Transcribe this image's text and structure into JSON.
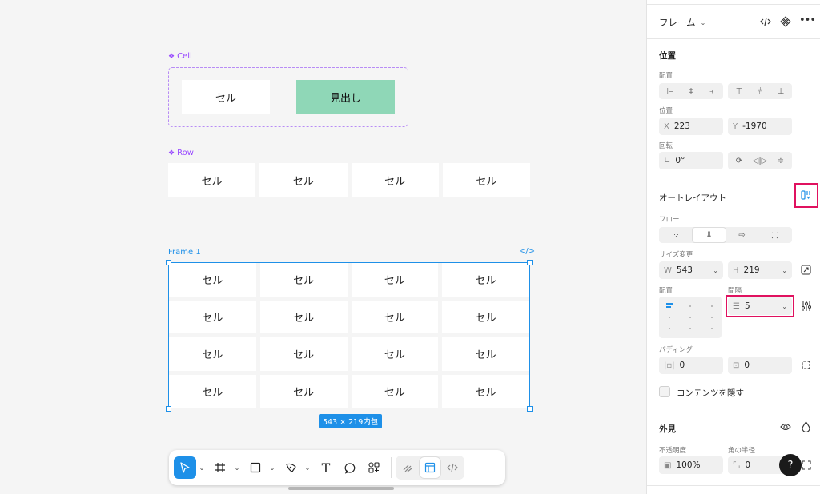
{
  "canvas": {
    "cell_component": {
      "label": "Cell",
      "cell_text": "セル",
      "heading_text": "見出し"
    },
    "row_component": {
      "label": "Row",
      "cells": [
        "セル",
        "セル",
        "セル",
        "セル"
      ]
    },
    "frame": {
      "label": "Frame 1",
      "code_icon": "</>",
      "cells": [
        "セル",
        "セル",
        "セル",
        "セル",
        "セル",
        "セル",
        "セル",
        "セル",
        "セル",
        "セル",
        "セル",
        "セル",
        "セル",
        "セル",
        "セル",
        "セル"
      ],
      "size_badge": "543 × 219内包"
    }
  },
  "toolbar": {
    "tools": [
      {
        "name": "move-tool",
        "icon": "cursor-icon",
        "active": true
      },
      {
        "name": "frame-tool",
        "icon": "hash-icon"
      },
      {
        "name": "shape-tool",
        "icon": "square-icon"
      },
      {
        "name": "pen-tool",
        "icon": "pen-icon"
      },
      {
        "name": "text-tool",
        "icon": "text-icon"
      },
      {
        "name": "comment-tool",
        "icon": "comment-icon"
      },
      {
        "name": "component-tool",
        "icon": "components-icon"
      }
    ],
    "text_tool_glyph": "T"
  },
  "panel": {
    "header": {
      "title": "フレーム",
      "more": "•••"
    },
    "position": {
      "title": "位置",
      "align_label": "配置",
      "position_label": "位置",
      "x_prefix": "X",
      "x_value": "223",
      "y_prefix": "Y",
      "y_value": "-1970",
      "rotation_label": "回転",
      "rotation_value": "0°"
    },
    "auto_layout": {
      "title": "オートレイアウト",
      "flow_label": "フロー",
      "resize_label": "サイズ変更",
      "w_prefix": "W",
      "w_value": "543",
      "h_prefix": "H",
      "h_value": "219",
      "align_label": "配置",
      "gap_label": "間隔",
      "gap_value": "5",
      "padding_label": "パディング",
      "padding_h": "0",
      "padding_v": "0",
      "clip_label": "コンテンツを隠す"
    },
    "appearance": {
      "title": "外見",
      "opacity_label": "不透明度",
      "opacity_value": "100%",
      "radius_label": "角の半径",
      "radius_value": "0"
    },
    "help": "?"
  },
  "colors": {
    "accent": "#1e90e8",
    "component": "#9747ff",
    "heading_fill": "#8fd7b7",
    "highlight": "#e0115f"
  }
}
